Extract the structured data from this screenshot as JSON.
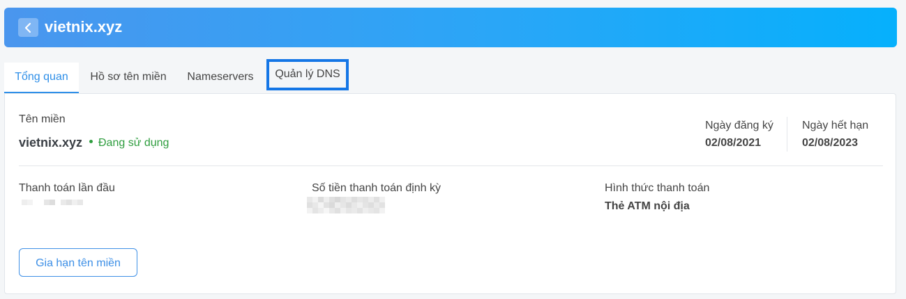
{
  "header": {
    "title": "vietnix.xyz",
    "back_icon": "chevron-left-icon"
  },
  "tabs": [
    {
      "label": "Tổng quan",
      "active": true
    },
    {
      "label": "Hồ sơ tên miền",
      "active": false
    },
    {
      "label": "Nameservers",
      "active": false
    },
    {
      "label": "Quản lý DNS",
      "active": false,
      "highlighted": true
    }
  ],
  "overview": {
    "domain_label": "Tên miền",
    "domain_value": "vietnix.xyz",
    "status": "Đang sử dụng",
    "registration_label": "Ngày đăng ký",
    "registration_date": "02/08/2021",
    "expiry_label": "Ngày hết hạn",
    "expiry_date": "02/08/2023",
    "first_payment_label": "Thanh toán lần đầu",
    "recurring_amount_label": "Số tiền thanh toán định kỳ",
    "payment_method_label": "Hình thức thanh toán",
    "payment_method_value": "Thẻ ATM nội địa",
    "renew_button": "Gia hạn tên miền"
  },
  "colors": {
    "accent": "#2f8fe8",
    "status_green": "#2e9d3e",
    "highlight_border": "#1476e6"
  }
}
